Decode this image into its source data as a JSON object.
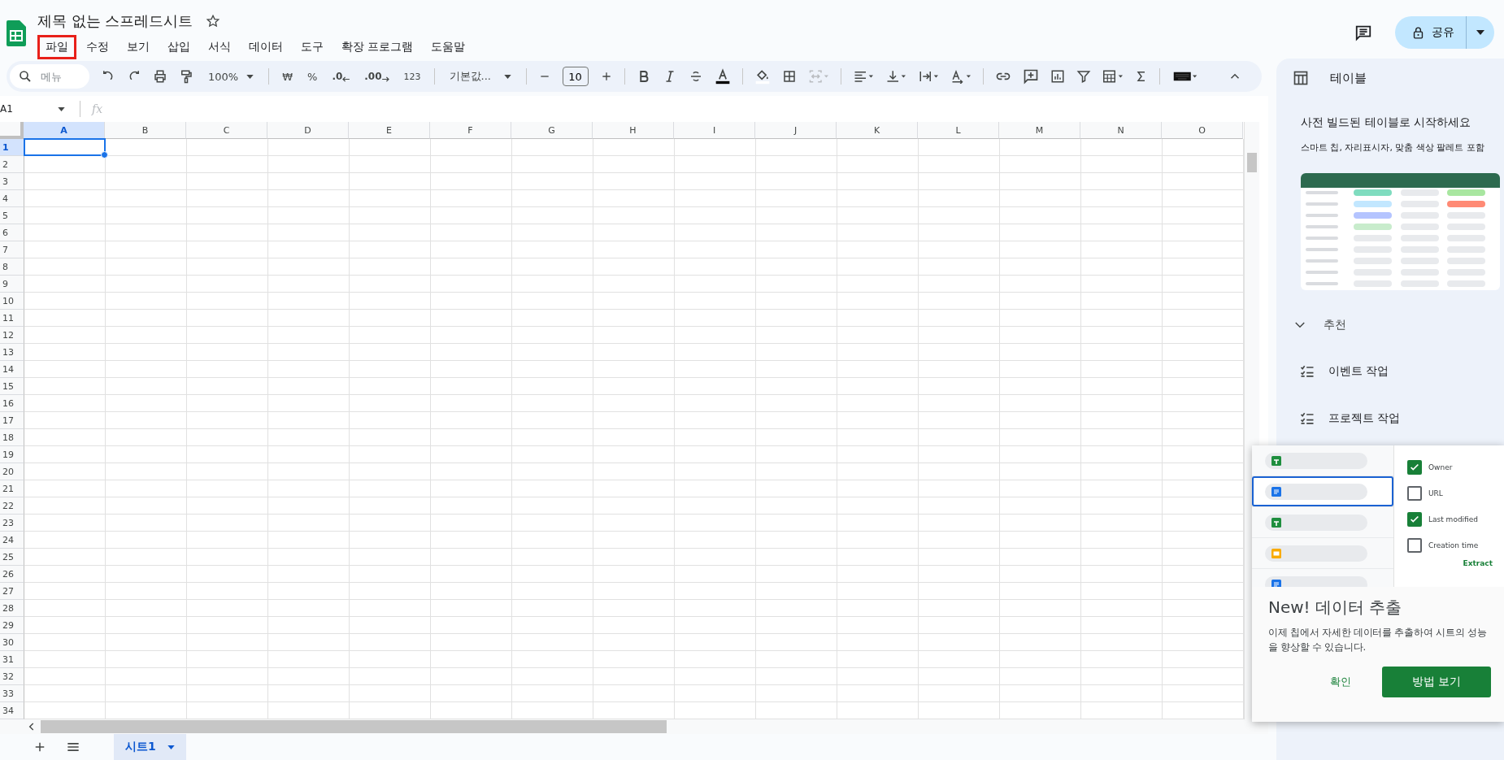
{
  "document": {
    "title": "제목 없는 스프레드시트"
  },
  "menu": [
    {
      "label": "파일",
      "highlighted": true
    },
    {
      "label": "수정",
      "highlighted": false
    },
    {
      "label": "보기",
      "highlighted": false
    },
    {
      "label": "삽입",
      "highlighted": false
    },
    {
      "label": "서식",
      "highlighted": false
    },
    {
      "label": "데이터",
      "highlighted": false
    },
    {
      "label": "도구",
      "highlighted": false
    },
    {
      "label": "확장 프로그램",
      "highlighted": false
    },
    {
      "label": "도움말",
      "highlighted": false
    }
  ],
  "share_button": {
    "label": "공유"
  },
  "toolbar": {
    "search_placeholder": "메뉴",
    "zoom": "100%",
    "currency": "₩",
    "percent": "%",
    "decrease_decimal": ".0",
    "increase_decimal": ".00",
    "number_format": "123",
    "font": "기본값...",
    "font_size": "10"
  },
  "formula_bar": {
    "name_box": "A1",
    "fx": "fx"
  },
  "grid": {
    "columns": [
      {
        "label": "A",
        "selected": true
      },
      {
        "label": "B",
        "selected": false
      },
      {
        "label": "C",
        "selected": false
      },
      {
        "label": "D",
        "selected": false
      },
      {
        "label": "E",
        "selected": false
      },
      {
        "label": "F",
        "selected": false
      },
      {
        "label": "G",
        "selected": false
      },
      {
        "label": "H",
        "selected": false
      },
      {
        "label": "I",
        "selected": false
      },
      {
        "label": "J",
        "selected": false
      },
      {
        "label": "K",
        "selected": false
      },
      {
        "label": "L",
        "selected": false
      },
      {
        "label": "M",
        "selected": false
      },
      {
        "label": "N",
        "selected": false
      },
      {
        "label": "O",
        "selected": false
      }
    ],
    "rows": [
      {
        "label": "1",
        "selected": true
      },
      {
        "label": "2",
        "selected": false
      },
      {
        "label": "3",
        "selected": false
      },
      {
        "label": "4",
        "selected": false
      },
      {
        "label": "5",
        "selected": false
      },
      {
        "label": "6",
        "selected": false
      },
      {
        "label": "7",
        "selected": false
      },
      {
        "label": "8",
        "selected": false
      },
      {
        "label": "9",
        "selected": false
      },
      {
        "label": "10",
        "selected": false
      },
      {
        "label": "11",
        "selected": false
      },
      {
        "label": "12",
        "selected": false
      },
      {
        "label": "13",
        "selected": false
      },
      {
        "label": "14",
        "selected": false
      },
      {
        "label": "15",
        "selected": false
      },
      {
        "label": "16",
        "selected": false
      },
      {
        "label": "17",
        "selected": false
      },
      {
        "label": "18",
        "selected": false
      },
      {
        "label": "19",
        "selected": false
      },
      {
        "label": "20",
        "selected": false
      },
      {
        "label": "21",
        "selected": false
      },
      {
        "label": "22",
        "selected": false
      },
      {
        "label": "23",
        "selected": false
      },
      {
        "label": "24",
        "selected": false
      },
      {
        "label": "25",
        "selected": false
      },
      {
        "label": "26",
        "selected": false
      },
      {
        "label": "27",
        "selected": false
      },
      {
        "label": "28",
        "selected": false
      },
      {
        "label": "29",
        "selected": false
      },
      {
        "label": "30",
        "selected": false
      },
      {
        "label": "31",
        "selected": false
      },
      {
        "label": "32",
        "selected": false
      },
      {
        "label": "33",
        "selected": false
      },
      {
        "label": "34",
        "selected": false
      }
    ]
  },
  "sheet_tabs": [
    {
      "label": "시트1",
      "selected": true
    }
  ],
  "sidebar": {
    "title": "테이블",
    "heading": "사전 빌드된 테이블로 시작하세요",
    "subtext": "스마트 칩, 자리표시자, 맞춤 색상 팔레트 포함",
    "section": {
      "label": "추천",
      "expanded": true
    },
    "items": [
      {
        "label": "이벤트 작업"
      },
      {
        "label": "프로젝트 작업"
      }
    ]
  },
  "popup": {
    "files": [
      {
        "kind": "sheets",
        "selected": false
      },
      {
        "kind": "docs",
        "selected": true
      },
      {
        "kind": "sheets",
        "selected": false
      },
      {
        "kind": "slides",
        "selected": false
      },
      {
        "kind": "docs",
        "selected": false
      }
    ],
    "fields": [
      {
        "label": "Owner",
        "checked": true
      },
      {
        "label": "URL",
        "checked": false
      },
      {
        "label": "Last modified",
        "checked": true
      },
      {
        "label": "Creation time",
        "checked": false
      }
    ],
    "extract": "Extract",
    "title": "New! 데이터 추출",
    "body": "이제 칩에서 자세한 데이터를 추출하여 시트의 성능을 향상할 수 있습니다.",
    "dismiss": "확인",
    "primary": "방법 보기"
  }
}
